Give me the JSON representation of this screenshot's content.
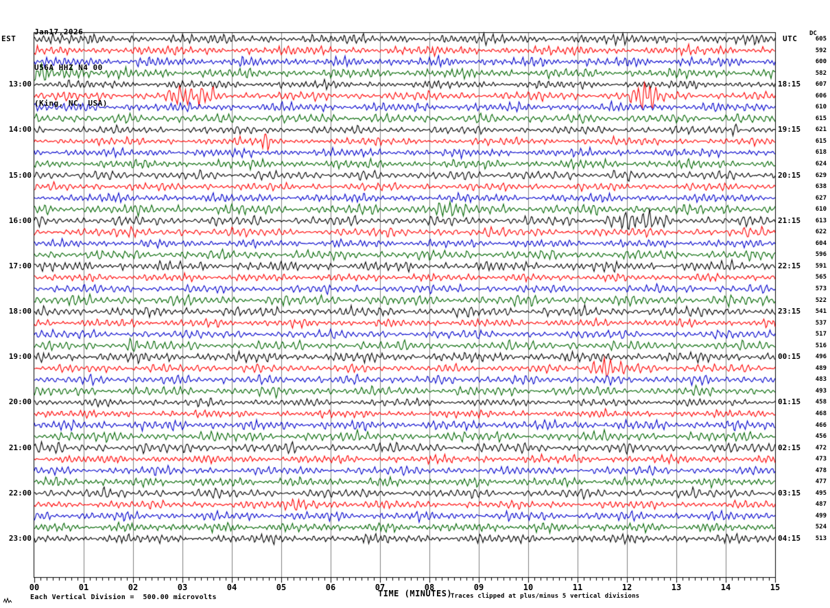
{
  "header": {
    "date": "Jan17,2026",
    "station": "U56A HHZ N4 00",
    "location": "(King, NC, USA)"
  },
  "axes": {
    "left_label": "EST",
    "right_label": "UTC",
    "dc_label": "DC",
    "x_title": "TIME (MINUTES)",
    "x_ticks": [
      "00",
      "01",
      "02",
      "03",
      "04",
      "05",
      "06",
      "07",
      "08",
      "09",
      "10",
      "11",
      "12",
      "13",
      "14",
      "15"
    ]
  },
  "footer": {
    "scale_note": "Each Vertical Division =  500.00 microvolts",
    "clip_note": "Traces clipped at plus/minus 5 vertical divisions"
  },
  "colors": {
    "black": "#000000",
    "red": "#ff0000",
    "blue": "#0000cc",
    "green": "#006600",
    "grid": "#808080",
    "border": "#000000"
  },
  "chart_data": {
    "type": "seismogram-helicorder",
    "minutes_per_row": 15,
    "x_range": [
      0,
      15
    ],
    "rows_count": 45,
    "row_color_cycle": [
      "black",
      "red",
      "blue",
      "green"
    ],
    "dc_values": [
      605,
      592,
      600,
      582,
      607,
      606,
      610,
      615,
      621,
      615,
      618,
      624,
      629,
      638,
      627,
      610,
      613,
      622,
      604,
      596,
      591,
      565,
      573,
      522,
      541,
      537,
      517,
      516,
      496,
      489,
      483,
      493,
      458,
      468,
      466,
      456,
      472,
      473,
      478,
      477,
      495,
      487,
      499,
      524,
      513
    ],
    "time_labels": [
      {
        "row": 4,
        "est": "13:00",
        "utc": "18:15"
      },
      {
        "row": 8,
        "est": "14:00",
        "utc": "19:15"
      },
      {
        "row": 12,
        "est": "15:00",
        "utc": "20:15"
      },
      {
        "row": 16,
        "est": "16:00",
        "utc": "21:15"
      },
      {
        "row": 20,
        "est": "17:00",
        "utc": "22:15"
      },
      {
        "row": 24,
        "est": "18:00",
        "utc": "23:15"
      },
      {
        "row": 28,
        "est": "19:00",
        "utc": "00:15"
      },
      {
        "row": 32,
        "est": "20:00",
        "utc": "01:15"
      },
      {
        "row": 36,
        "est": "21:00",
        "utc": "02:15"
      },
      {
        "row": 40,
        "est": "22:00",
        "utc": "03:15"
      },
      {
        "row": 44,
        "est": "23:00",
        "utc": "04:15"
      }
    ],
    "events": [
      {
        "row": 3,
        "minute": 0.5,
        "amp": 1.9,
        "width": 0.5
      },
      {
        "row": 5,
        "minute": 3.2,
        "amp": 1.6,
        "width": 0.5
      },
      {
        "row": 5,
        "minute": 12.35,
        "amp": 2.8,
        "width": 0.3
      },
      {
        "row": 8,
        "minute": 14.2,
        "amp": 3.6,
        "width": 0.07
      },
      {
        "row": 9,
        "minute": 4.65,
        "amp": 2.0,
        "width": 0.12
      },
      {
        "row": 15,
        "minute": 8.15,
        "amp": 1.8,
        "width": 0.3
      },
      {
        "row": 16,
        "minute": 12.1,
        "amp": 1.8,
        "width": 0.45
      },
      {
        "row": 27,
        "minute": 2.05,
        "amp": 1.8,
        "width": 0.12
      },
      {
        "row": 29,
        "minute": 11.55,
        "amp": 2.4,
        "width": 0.4
      },
      {
        "row": 41,
        "minute": 5.6,
        "amp": 2.0,
        "width": 0.35
      }
    ]
  }
}
